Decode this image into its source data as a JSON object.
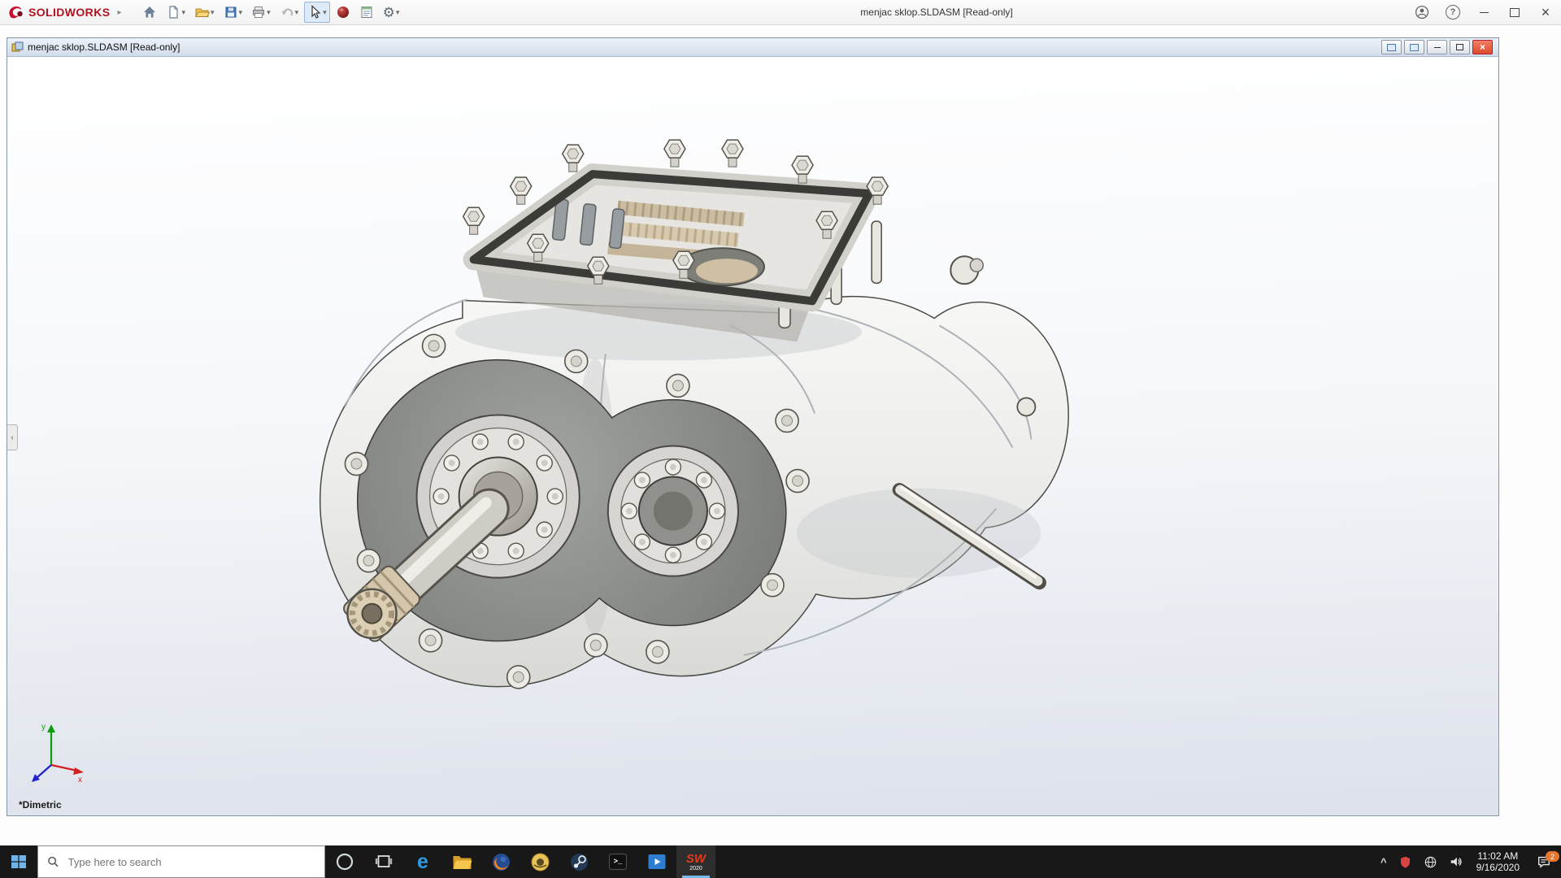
{
  "app": {
    "brand": "SOLIDWORKS",
    "title": "menjac sklop.SLDASM [Read-only]",
    "toolbar_buttons": [
      "home",
      "new-document",
      "open",
      "save",
      "print",
      "undo",
      "select",
      "3dexperience",
      "file-properties",
      "options"
    ]
  },
  "doc": {
    "title": "menjac sklop.SLDASM [Read-only]",
    "view_label": "*Dimetric",
    "axes": {
      "x": "x",
      "y": "y"
    }
  },
  "taskbar": {
    "search_placeholder": "Type here to search",
    "pinned_apps": [
      "cortana",
      "task-view",
      "edge",
      "file-explorer",
      "firefox",
      "media-app",
      "steam",
      "command-prompt",
      "movies-tv",
      "solidworks-2020"
    ],
    "solidworks_year": "2020",
    "tray": {
      "time": "11:02 AM",
      "date": "9/16/2020",
      "notification_count": "2"
    }
  },
  "icons": {
    "caret": "▾",
    "menu_arrow": "▸",
    "tray_caret": "^",
    "close": "×",
    "help": "?",
    "gear": "⚙",
    "edge_glyph": "e",
    "prompt_glyph": "&gt;_",
    "sw_glyph": "SW",
    "panel_collapse": "‹"
  }
}
